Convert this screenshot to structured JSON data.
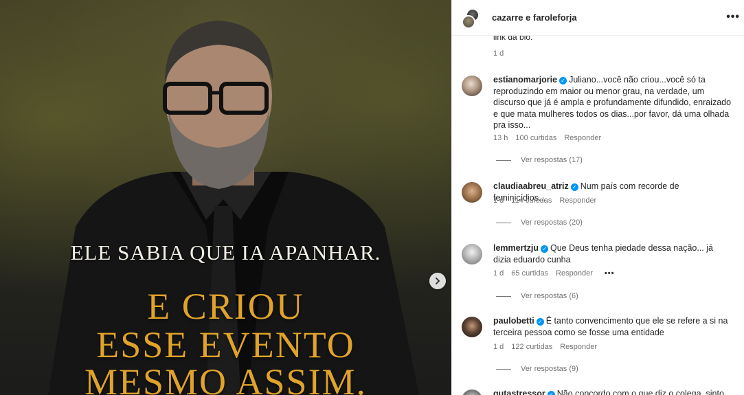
{
  "post": {
    "slide_line1": "ELE SABIA QUE IA APANHAR.",
    "slide_line2": "E CRIOU",
    "slide_line3": "ESSE EVENTO",
    "slide_line4": "MESMO ASSIM.",
    "next_icon": "chevron-right-icon",
    "colors": {
      "gold": "#e0a32a",
      "white_text": "#f2efe6"
    }
  },
  "header": {
    "user": "cazarre e faroleforja",
    "more_icon": "more-horizontal-icon",
    "more": "•••"
  },
  "previous": {
    "text": "link da bio.",
    "time": "1 d"
  },
  "comments": [
    {
      "user": "estianomarjorie",
      "verified": true,
      "text": "Juliano...você não criou...você só ta reproduzindo em maior ou menor grau, na verdade, um discurso que já é ampla e profundamente difundido, enraizado e que mata mulheres todos os dias...por favor, dá uma olhada pra isso...",
      "time": "13 h",
      "likes": "100 curtidas",
      "reply": "Responder",
      "view_replies": "Ver respostas (17)"
    },
    {
      "user": "claudiaabreu_atriz",
      "verified": true,
      "text": "Num país com recorde de feminicídios...",
      "time": "1 d",
      "likes": "114 curtidas",
      "reply": "Responder",
      "view_replies": "Ver respostas (20)"
    },
    {
      "user": "lemmertzju",
      "verified": true,
      "text": "Que Deus tenha piedade dessa nação... já dizia eduardo cunha",
      "time": "1 d",
      "likes": "65 curtidas",
      "reply": "Responder",
      "more": "•••",
      "view_replies": "Ver respostas (6)"
    },
    {
      "user": "paulobetti",
      "verified": true,
      "text": "É tanto convencimento que ele se refere a si na terceira pessoa como se fosse uma entidade",
      "time": "1 d",
      "likes": "122 curtidas",
      "reply": "Responder",
      "view_replies": "Ver respostas (9)"
    },
    {
      "user": "gutastressor",
      "verified": true,
      "text": "Não concordo com o que diz o colega, sinto"
    }
  ],
  "verified_badge": "✓",
  "colors": {
    "accent_blue": "#0095f6",
    "meta_gray": "#737373"
  }
}
